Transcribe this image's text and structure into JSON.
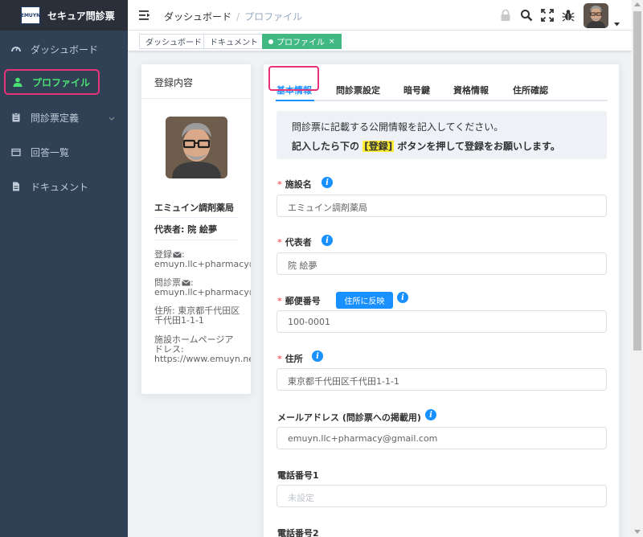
{
  "app": {
    "logo_text": "EMUYN",
    "title": "セキュア問診票"
  },
  "sidebar": {
    "items": [
      {
        "label": "ダッシュボード",
        "icon": "dashboard-icon"
      },
      {
        "label": "プロファイル",
        "icon": "user-icon",
        "active": true
      },
      {
        "label": "問診票定義",
        "icon": "clipboard-icon",
        "expandable": true
      },
      {
        "label": "回答一覧",
        "icon": "list-icon"
      },
      {
        "label": "ドキュメント",
        "icon": "document-icon"
      }
    ]
  },
  "navbar": {
    "breadcrumb": [
      "ダッシュボード",
      "プロファイル"
    ],
    "icons": [
      "lock-icon",
      "search-icon",
      "fullscreen-icon",
      "bug-icon"
    ]
  },
  "tags": [
    {
      "label": "ダッシュボード"
    },
    {
      "label": "ドキュメント"
    },
    {
      "label": "プロファイル",
      "active": true,
      "close": "×"
    }
  ],
  "profile_card": {
    "title": "登録内容",
    "facility": "エミュイン調剤薬局",
    "representative": "代表者: 院 絵夢",
    "reg_email_label": "登録",
    "reg_email_value": "emuyn.llc+pharmacy@gmail.com",
    "form_email_label": "問診票",
    "form_email_value": "emuyn.llc+pharmacy@gmail.com",
    "address_line1": "住所: 東京都千代田区",
    "address_line2": "千代田1-1-1",
    "homepage_line1": "施設ホームページア",
    "homepage_line2": "ドレス:",
    "homepage_value": "https://www.emuyn.net/"
  },
  "form": {
    "tabs": [
      "基本情報",
      "問診票設定",
      "暗号鍵",
      "資格情報",
      "住所確認"
    ],
    "active_tab": 0,
    "notice_line1": "問診票に記載する公開情報を記入してください。",
    "notice_line2_pre": "記入したら下の",
    "notice_line2_hl": "[登録]",
    "notice_line2_post": "ボタンを押して登録をお願いします。",
    "fields": {
      "facility_name": {
        "label": "施設名",
        "value": "エミュイン調剤薬局",
        "required": true
      },
      "representative": {
        "label": "代表者",
        "value": "院 絵夢",
        "required": true
      },
      "postal_code": {
        "label": "郵便番号",
        "value": "100-0001",
        "required": true,
        "button": "住所に反映"
      },
      "address": {
        "label": "住所",
        "value": "東京都千代田区千代田1-1-1",
        "required": true
      },
      "email": {
        "label": "メールアドレス (問診票への掲載用)",
        "value": "emuyn.llc+pharmacy@gmail.com"
      },
      "phone1": {
        "label": "電話番号1",
        "placeholder": "未設定"
      },
      "phone2": {
        "label": "電話番号2"
      }
    }
  },
  "colors": {
    "sidebar_bg": "#304156",
    "active_menu_text": "#4be072",
    "highlight_border": "#e8337a",
    "primary": "#1890ff",
    "tag_active": "#42b983",
    "required": "#f56c6c"
  }
}
